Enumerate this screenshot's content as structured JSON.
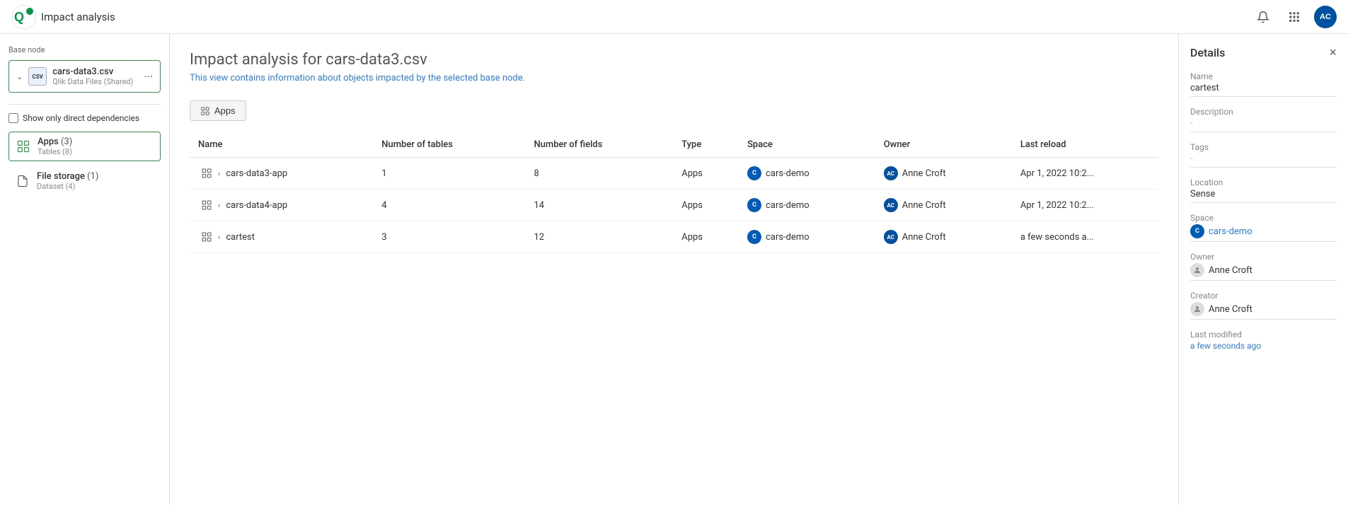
{
  "topbar": {
    "title": "Impact analysis",
    "logo_text": "Qlik",
    "avatar_initials": "AC"
  },
  "left_panel": {
    "base_node_label": "Base node",
    "node_name": "cars-data3.csv",
    "node_sub": "Qlik Data Files (Shared)",
    "deps_checkbox_label": "Show only direct dependencies",
    "tree_items": [
      {
        "name": "Apps",
        "count": "(3)",
        "sub": "Tables (8)",
        "active": true
      },
      {
        "name": "File storage",
        "count": "(1)",
        "sub": "Dataset (4)",
        "active": false
      }
    ]
  },
  "main": {
    "title": "Impact analysis for cars-data3.csv",
    "subtitle": "This view contains information about objects impacted by the selected base node.",
    "tab_label": "Apps",
    "table": {
      "headers": [
        "Name",
        "Number of tables",
        "Number of fields",
        "Type",
        "Space",
        "Owner",
        "Last reload"
      ],
      "rows": [
        {
          "name": "cars-data3-app",
          "expanded": false,
          "num_tables": "1",
          "num_fields": "8",
          "type": "Apps",
          "space": "cars-demo",
          "owner": "Anne Croft",
          "last_reload": "Apr 1, 2022 10:2..."
        },
        {
          "name": "cars-data4-app",
          "expanded": false,
          "num_tables": "4",
          "num_fields": "14",
          "type": "Apps",
          "space": "cars-demo",
          "owner": "Anne Croft",
          "last_reload": "Apr 1, 2022 10:2..."
        },
        {
          "name": "cartest",
          "expanded": false,
          "num_tables": "3",
          "num_fields": "12",
          "type": "Apps",
          "space": "cars-demo",
          "owner": "Anne Croft",
          "last_reload": "a few seconds a..."
        }
      ]
    }
  },
  "right_panel": {
    "title": "Details",
    "sections": [
      {
        "label": "Name",
        "value": "cartest",
        "type": "text"
      },
      {
        "label": "Description",
        "value": "-",
        "type": "dash"
      },
      {
        "label": "Tags",
        "value": "-",
        "type": "dash"
      },
      {
        "label": "Location",
        "value": "Sense",
        "type": "text"
      },
      {
        "label": "Space",
        "value": "cars-demo",
        "type": "space"
      },
      {
        "label": "Owner",
        "value": "Anne Croft",
        "type": "person"
      },
      {
        "label": "Creator",
        "value": "Anne Croft",
        "type": "person"
      },
      {
        "label": "Last modified",
        "value": "a few seconds ago",
        "type": "modified"
      }
    ]
  },
  "icons": {
    "chevron_right": "›",
    "chevron_down": "⌄",
    "bell": "🔔",
    "grid": "⊞",
    "close": "×",
    "apps_tab": "🖼"
  }
}
